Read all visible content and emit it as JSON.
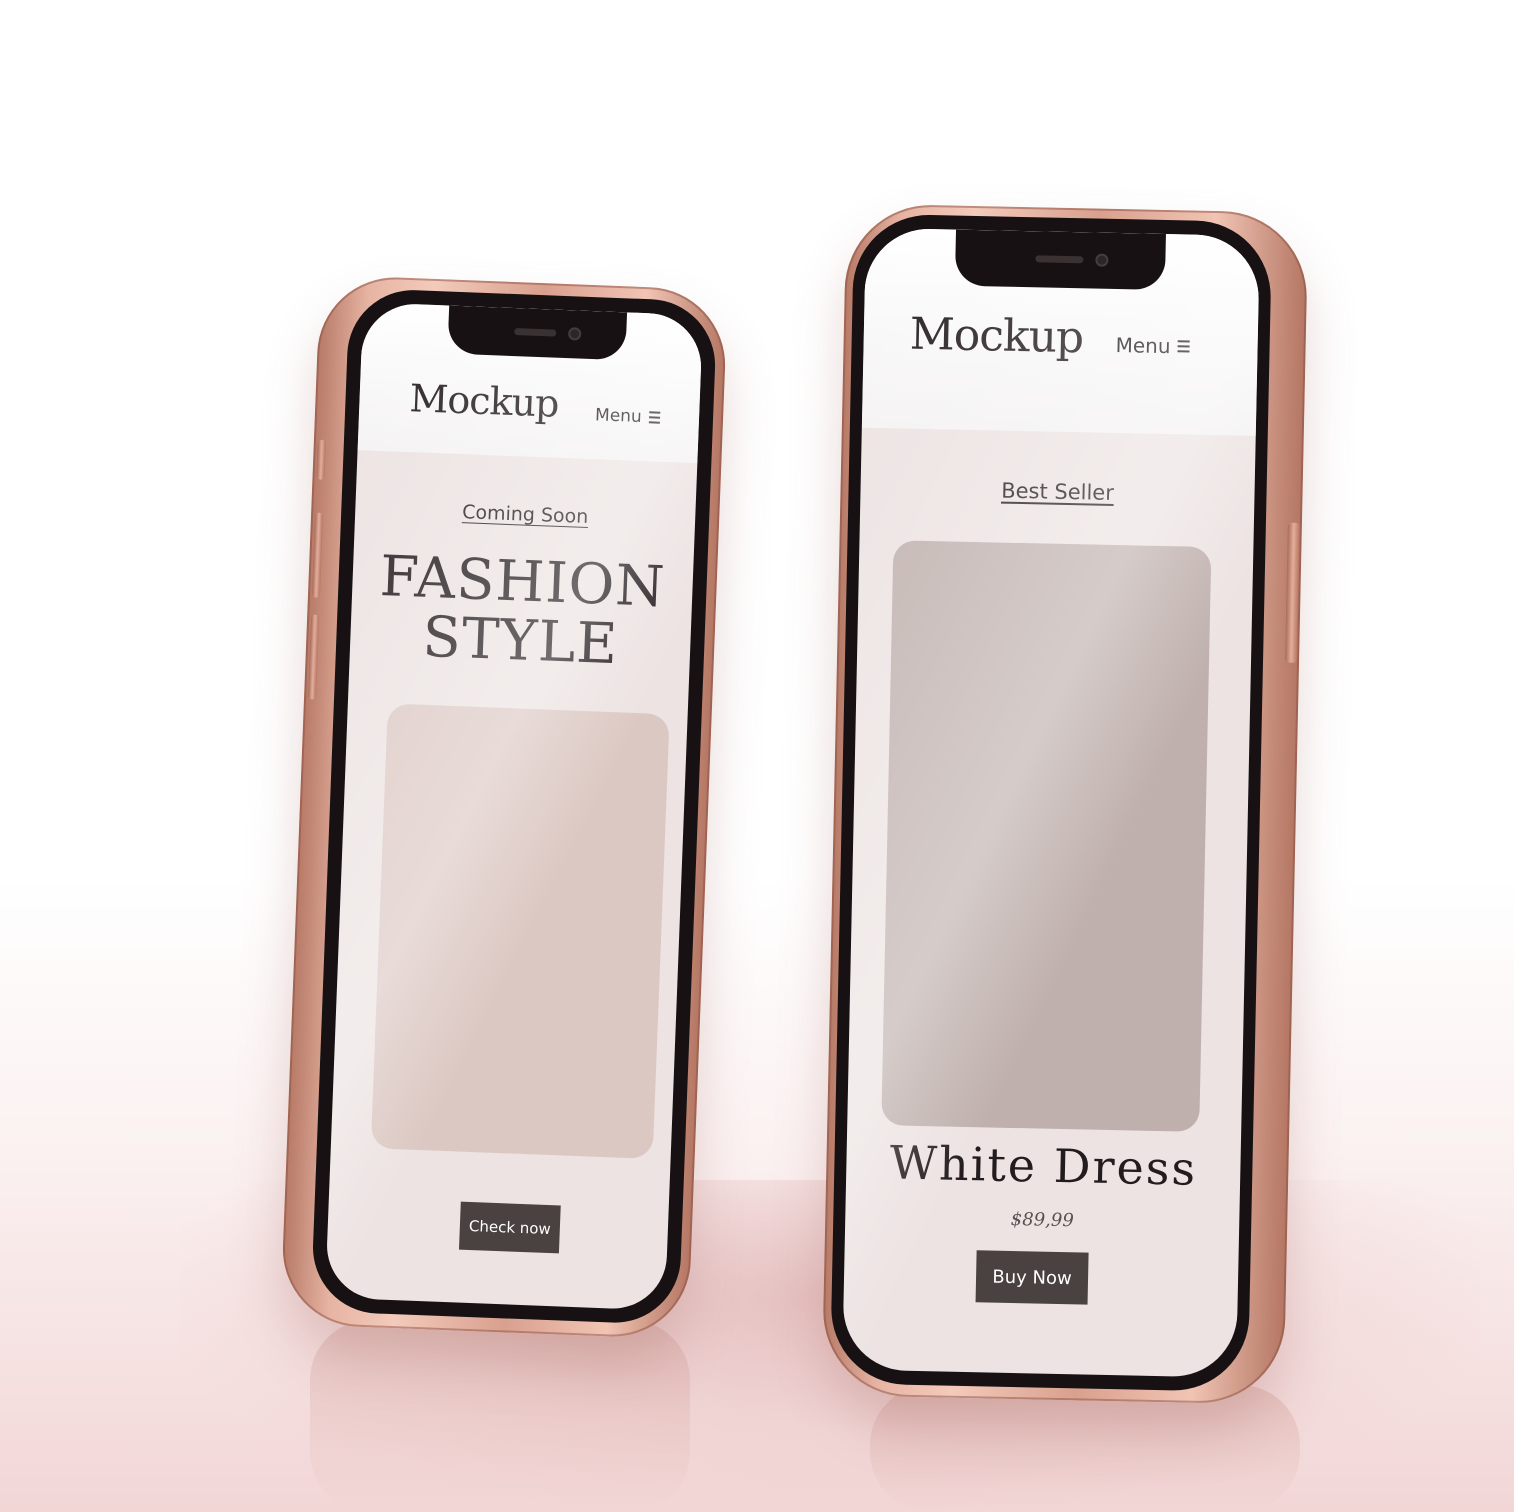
{
  "phone_left": {
    "brand": "Mockup",
    "menu_label": "Menu",
    "section_label": "Coming Soon",
    "headline_line1": "FASHION",
    "headline_line2": "STYLE",
    "cta_label": "Check now"
  },
  "phone_right": {
    "brand": "Mockup",
    "menu_label": "Menu",
    "section_label": "Best Seller",
    "product_name": "White Dress",
    "price": "$89,99",
    "cta_label": "Buy Now"
  },
  "colors": {
    "frame": "#e2aa98",
    "bezel": "#171113",
    "screen_bg": "#ece3e2",
    "left_image_placeholder": "#dcc8c3",
    "right_image_placeholder": "#bfb0ad",
    "button": "#4a4240",
    "text": "#231c1e"
  }
}
